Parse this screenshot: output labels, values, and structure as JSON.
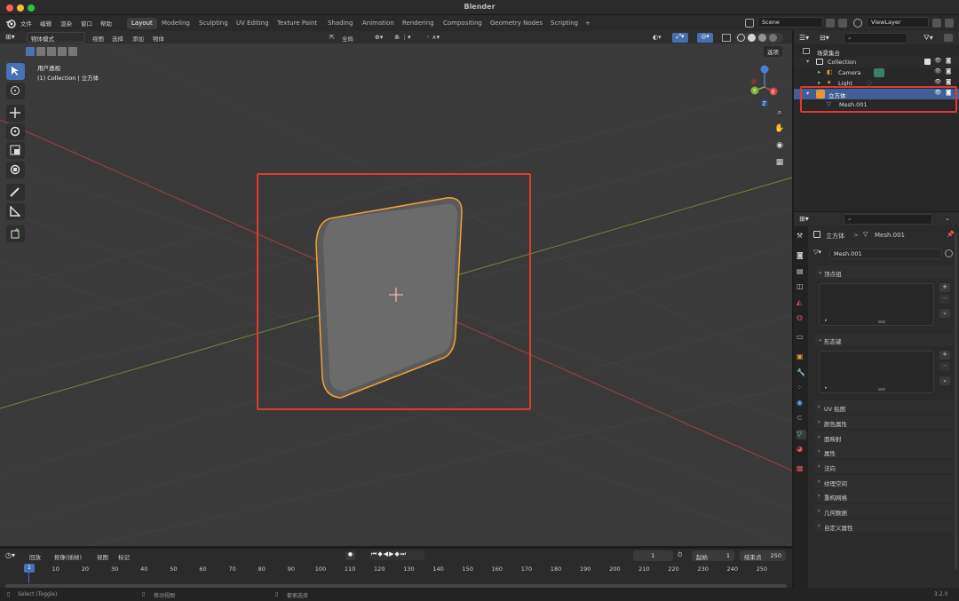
{
  "window": {
    "title": "Blender"
  },
  "menu": [
    "文件",
    "编辑",
    "渲染",
    "窗口",
    "帮助"
  ],
  "workspaces": [
    "Layout",
    "Modeling",
    "Sculpting",
    "UV Editing",
    "Texture Paint",
    "Shading",
    "Animation",
    "Rendering",
    "Compositing",
    "Geometry Nodes",
    "Scripting"
  ],
  "active_workspace": "Layout",
  "add_workspace": "+",
  "scene": {
    "name": "Scene",
    "viewlayer": "ViewLayer"
  },
  "viewport": {
    "mode": "物体模式",
    "menus": [
      "视图",
      "选择",
      "添加",
      "物体"
    ],
    "transform": "全局",
    "select_label": "选项",
    "info_line1": "用户透视",
    "info_line2": "(1) Collection | 立方体",
    "gizmo": {
      "x": "X",
      "y": "Y",
      "z": "Z"
    }
  },
  "outliner": {
    "root": "场景集合",
    "collection": "Collection",
    "items": [
      {
        "name": "Camera"
      },
      {
        "name": "Light"
      },
      {
        "name": "立方体"
      },
      {
        "name": "Mesh.001"
      }
    ]
  },
  "properties": {
    "breadcrumb_obj": "立方体",
    "breadcrumb_sep": ">",
    "breadcrumb_mesh": "Mesh.001",
    "mesh_field": "Mesh.001",
    "panels_open": [
      "顶点组",
      "形态键"
    ],
    "panels_closed": [
      "UV 贴图",
      "颜色属性",
      "面映射",
      "属性",
      "法向",
      "纹理空间",
      "重构网格",
      "几何数据",
      "自定义属性"
    ]
  },
  "timeline": {
    "menus": [
      "回放",
      "抠像(插帧)",
      "视图",
      "标记"
    ],
    "current_frame": "1",
    "start_label": "起始",
    "start": "1",
    "end_label": "结束点",
    "end": "250",
    "ticks": [
      "1",
      "10",
      "20",
      "30",
      "40",
      "50",
      "60",
      "70",
      "80",
      "90",
      "100",
      "110",
      "120",
      "130",
      "140",
      "150",
      "160",
      "170",
      "180",
      "190",
      "200",
      "210",
      "220",
      "230",
      "240",
      "250"
    ]
  },
  "status": {
    "left": "Select (Toggle)",
    "mid": "移动视图",
    "right": "套索选择",
    "version": "3.2.0"
  }
}
